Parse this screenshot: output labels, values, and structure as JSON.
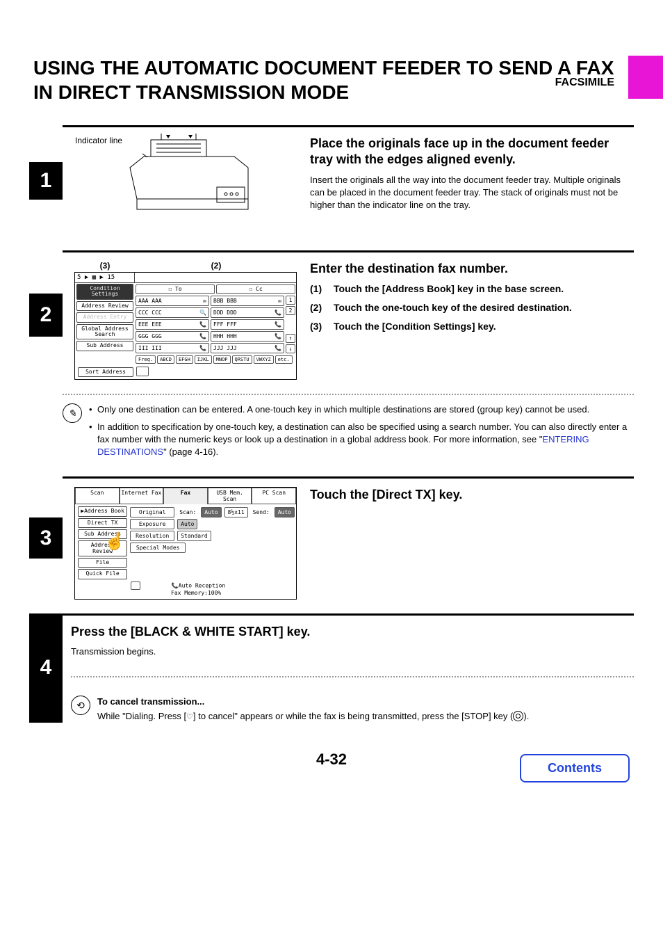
{
  "header": {
    "section": "FACSIMILE"
  },
  "title": "USING THE AUTOMATIC DOCUMENT FEEDER TO SEND A FAX IN DIRECT TRANSMISSION MODE",
  "steps": {
    "s1": {
      "num": "1",
      "indicator_label": "Indicator line",
      "heading": "Place the originals face up in the document feeder tray with the edges aligned evenly.",
      "body": "Insert the originals all the way into the document feeder tray. Multiple originals can be placed in the document feeder tray. The stack of originals must not be higher than the indicator line on the tray."
    },
    "s2": {
      "num": "2",
      "callout_a": "(3)",
      "callout_b": "(2)",
      "heading": "Enter the destination fax number.",
      "items": [
        {
          "n": "(1)",
          "t": "Touch the [Address Book] key in the base screen."
        },
        {
          "n": "(2)",
          "t": "Touch the one-touch key of the desired destination."
        },
        {
          "n": "(3)",
          "t": "Touch the [Condition Settings] key."
        }
      ],
      "note_bullets": [
        "Only one destination can be entered. A one-touch key in which multiple destinations are stored (group key) cannot be used.",
        "In addition to specification by one-touch key, a destination can also be specified using a search number. You can also directly enter a fax number with the numeric keys or look up a destination in a global address book. For more information, see \""
      ],
      "note_link": "ENTERING DESTINATIONS",
      "note_tail": "\" (page 4-16).",
      "screen": {
        "top_cell": "5 ▶ ▦ ▶ 15",
        "left_buttons": [
          "Condition Settings",
          "Address Review",
          "Address Entry",
          "Global Address Search",
          "Sub Address"
        ],
        "tabs": [
          "To",
          "Cc"
        ],
        "entries": [
          "AAA AAA",
          "BBB BBB",
          "CCC CCC",
          "DDD DDD",
          "EEE EEE",
          "FFF FFF",
          "GGG GGG",
          "HHH HHH",
          "III III",
          "JJJ JJJ"
        ],
        "scroll_labels": [
          "1",
          "2",
          "↑",
          "↓"
        ],
        "index_row": [
          "Freq.",
          "ABCD",
          "EFGH",
          "IJKL",
          "MNOP",
          "QRSTU",
          "VWXYZ",
          "etc."
        ],
        "sort_btn": "Sort Address"
      }
    },
    "s3": {
      "num": "3",
      "heading": "Touch the [Direct TX] key.",
      "screen": {
        "tabs": [
          "Scan",
          "Internet Fax",
          "Fax",
          "USB Mem. Scan",
          "PC Scan"
        ],
        "left_buttons": [
          "Address Book",
          "Direct TX",
          "Sub Address",
          "Address Review",
          "File",
          "Quick File"
        ],
        "rows": [
          {
            "label": "Original",
            "extra": "Scan:",
            "val": "Auto",
            "extra2": "8½x11",
            "extra3": "Send:",
            "val2": "Auto"
          },
          {
            "label": "Exposure",
            "val": "Auto"
          },
          {
            "label": "Resolution",
            "val": "Standard"
          },
          {
            "label": "Special Modes"
          }
        ],
        "footer1": "Auto Reception",
        "footer2": "Fax Memory:100%"
      }
    },
    "s4": {
      "num": "4",
      "heading": "Press the [BLACK & WHITE START] key.",
      "body": "Transmission begins.",
      "cancel_h": "To cancel transmission...",
      "cancel_body_a": "While \"Dialing. Press [",
      "cancel_body_b": "] to cancel\" appears or while the fax is being transmitted, press the [STOP] key (",
      "cancel_body_c": ")."
    }
  },
  "pagenum": "4-32",
  "contents_btn": "Contents"
}
